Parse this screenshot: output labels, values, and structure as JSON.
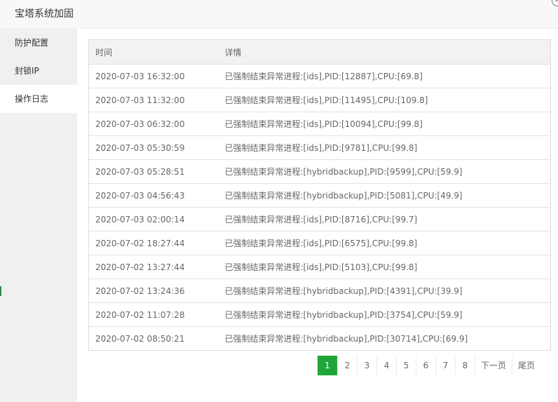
{
  "window": {
    "title": "宝塔系统加固",
    "close_glyph": "×"
  },
  "sidebar": {
    "items": [
      {
        "label": "防护配置",
        "active": false
      },
      {
        "label": "封锁IP",
        "active": false
      },
      {
        "label": "操作日志",
        "active": true
      }
    ]
  },
  "table": {
    "headers": {
      "time": "时间",
      "detail": "详情"
    },
    "rows": [
      {
        "time": "2020-07-03 16:32:00",
        "detail": "已强制结束异常进程:[ids],PID:[12887],CPU:[69.8]"
      },
      {
        "time": "2020-07-03 11:32:00",
        "detail": "已强制结束异常进程:[ids],PID:[11495],CPU:[109.8]"
      },
      {
        "time": "2020-07-03 06:32:00",
        "detail": "已强制结束异常进程:[ids],PID:[10094],CPU:[99.8]"
      },
      {
        "time": "2020-07-03 05:30:59",
        "detail": "已强制结束异常进程:[ids],PID:[9781],CPU:[99.8]"
      },
      {
        "time": "2020-07-03 05:28:51",
        "detail": "已强制结束异常进程:[hybridbackup],PID:[9599],CPU:[59.9]"
      },
      {
        "time": "2020-07-03 04:56:43",
        "detail": "已强制结束异常进程:[hybridbackup],PID:[5081],CPU:[49.9]"
      },
      {
        "time": "2020-07-03 02:00:14",
        "detail": "已强制结束异常进程:[ids],PID:[8716],CPU:[99.7]"
      },
      {
        "time": "2020-07-02 18:27:44",
        "detail": "已强制结束异常进程:[ids],PID:[6575],CPU:[99.8]"
      },
      {
        "time": "2020-07-02 13:27:44",
        "detail": "已强制结束异常进程:[ids],PID:[5103],CPU:[99.8]"
      },
      {
        "time": "2020-07-02 13:24:36",
        "detail": "已强制结束异常进程:[hybridbackup],PID:[4391],CPU:[39.9]"
      },
      {
        "time": "2020-07-02 11:07:28",
        "detail": "已强制结束异常进程:[hybridbackup],PID:[3754],CPU:[59.9]"
      },
      {
        "time": "2020-07-02 08:50:21",
        "detail": "已强制结束异常进程:[hybridbackup],PID:[30714],CPU:[69.9]"
      }
    ]
  },
  "pagination": {
    "pages": [
      "1",
      "2",
      "3",
      "4",
      "5",
      "6",
      "7",
      "8"
    ],
    "current": "1",
    "next_label": "下一页",
    "last_label": "尾页"
  },
  "colors": {
    "accent": "#20a53a",
    "sidebar_bg": "#f0f0f0",
    "header_bg": "#f2f2f2"
  }
}
